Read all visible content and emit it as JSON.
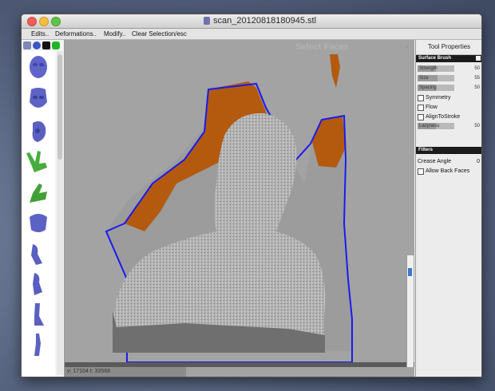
{
  "window": {
    "title": "scan_20120818180945.stl"
  },
  "menu": {
    "edits": "Edits..",
    "deformations": "Deformations..",
    "modify": "Modify..",
    "clear_selection": "Clear Selection/esc"
  },
  "toolbox": {
    "brushes": [
      {
        "name": "head-front-brush"
      },
      {
        "name": "face-mask-brush"
      },
      {
        "name": "head-side-brush"
      },
      {
        "name": "hand-peace-brush"
      },
      {
        "name": "hand-thumb-brush"
      },
      {
        "name": "torso-brush"
      },
      {
        "name": "arm-brush"
      },
      {
        "name": "leg-brush"
      },
      {
        "name": "foot-brush"
      },
      {
        "name": "figure-brush"
      }
    ]
  },
  "viewport": {
    "panel_title": "Select Faces",
    "panel_plus": "+",
    "status": "v: 17104 t: 33568"
  },
  "tool_properties": {
    "title": "Tool Properties",
    "surface_brush": {
      "header": "Surface Brush",
      "strength_label": "Strength",
      "strength": 50,
      "size_label": "Size",
      "size": 55,
      "spacing_label": "Spacing",
      "spacing": 50,
      "symmetry": "Symmetry",
      "flow": "Flow",
      "align": "AlignToStroke",
      "lazyness_label": "Lazyness",
      "lazyness": 50
    },
    "filters": {
      "header": "Filters",
      "crease_angle_label": "Crease Angle",
      "crease_angle": 0,
      "allow_back_faces": "Allow Back Faces"
    }
  },
  "colors": {
    "selection": "#b35a0f",
    "outline": "#1a1af0",
    "mesh": "#c7c7c7"
  }
}
